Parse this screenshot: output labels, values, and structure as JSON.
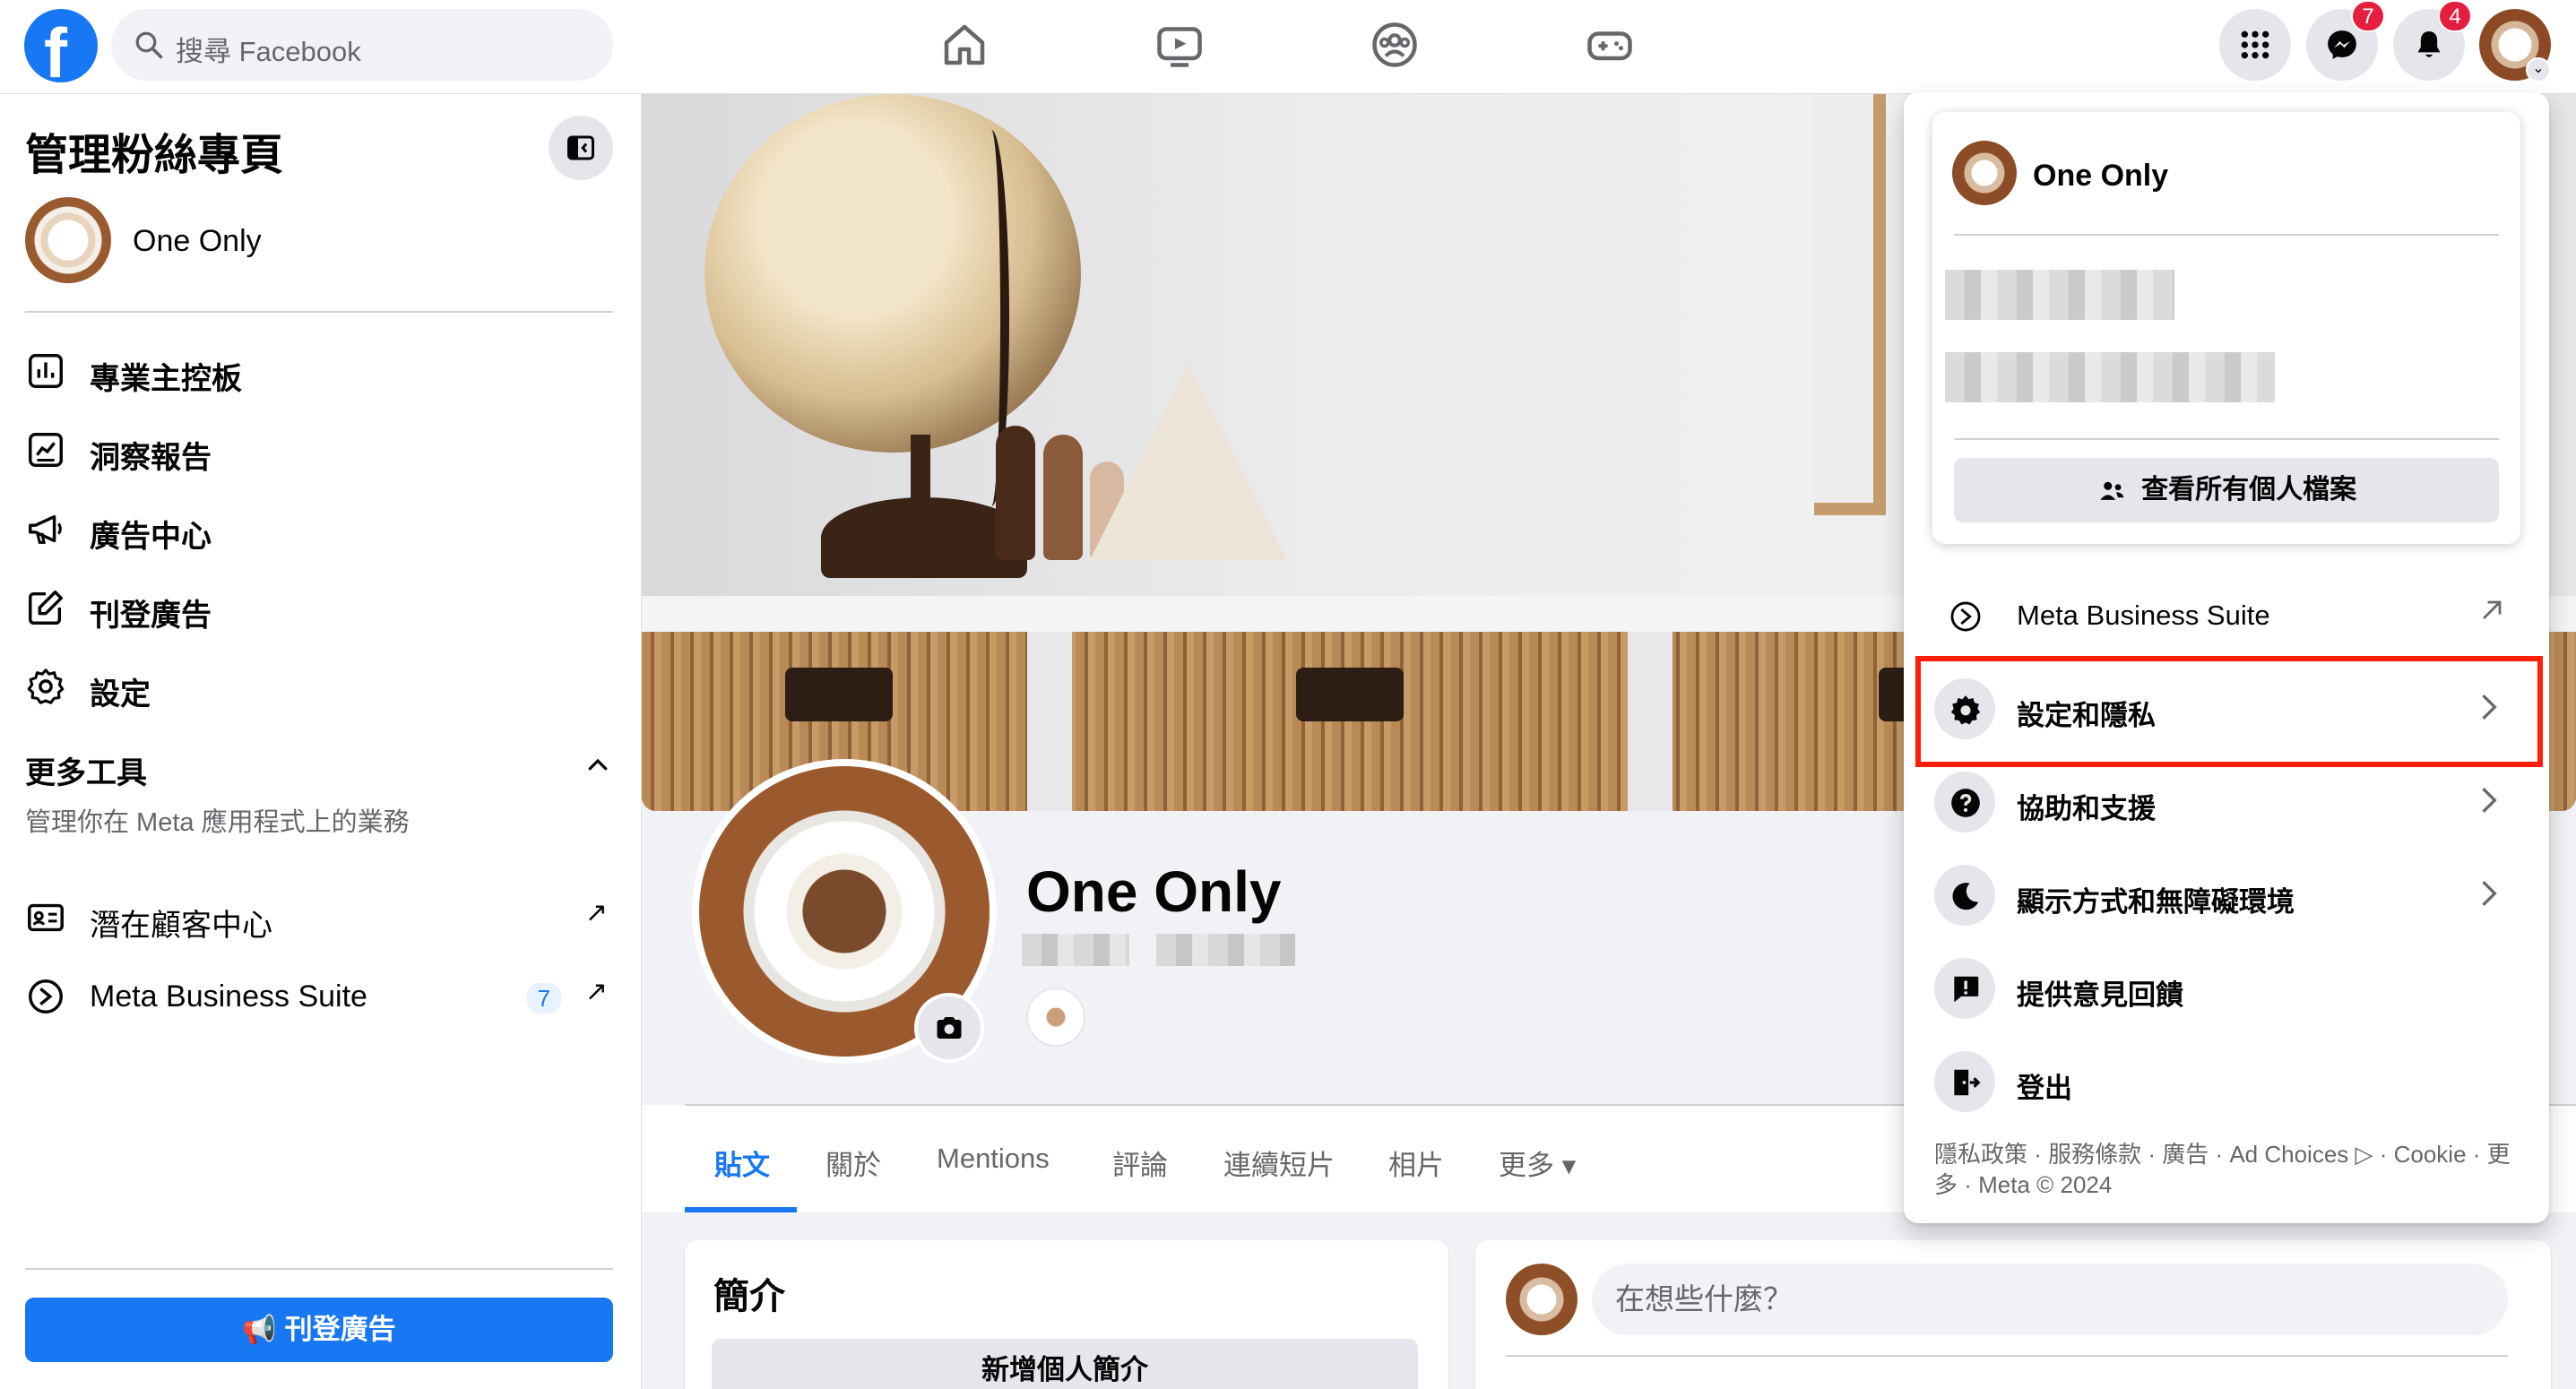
{
  "topbar": {
    "logo": "f",
    "search_placeholder": "搜尋 Facebook",
    "nav_icons": [
      "home-icon",
      "watch-icon",
      "groups-icon",
      "gaming-icon"
    ],
    "messenger_badge": "7",
    "notifications_badge": "4"
  },
  "sidebar": {
    "title": "管理粉絲專頁",
    "page_name": "One Only",
    "items": [
      {
        "label": "專業主控板",
        "icon": "dashboard-icon"
      },
      {
        "label": "洞察報告",
        "icon": "insights-icon"
      },
      {
        "label": "廣告中心",
        "icon": "megaphone-icon"
      },
      {
        "label": "刊登廣告",
        "icon": "edit-icon"
      },
      {
        "label": "設定",
        "icon": "gear-icon"
      }
    ],
    "more_tools_title": "更多工具",
    "more_tools_subtitle": "管理你在 Meta 應用程式上的業務",
    "tools": [
      {
        "label": "潛在顧客中心",
        "icon": "contact-card-icon",
        "ext": "↗"
      },
      {
        "label": "Meta Business Suite",
        "icon": "business-suite-icon",
        "count": "7",
        "ext": "↗"
      }
    ],
    "cta_label": "刊登廣告"
  },
  "profile": {
    "page_name": "One Only",
    "tabs": [
      {
        "label": "貼文",
        "active": true
      },
      {
        "label": "關於"
      },
      {
        "label": "Mentions"
      },
      {
        "label": "評論"
      },
      {
        "label": "連續短片"
      },
      {
        "label": "相片"
      },
      {
        "label": "更多 ▾"
      }
    ],
    "intro_title": "簡介",
    "intro_button": "新增個人簡介",
    "composer_placeholder": "在想些什麼？"
  },
  "account_menu": {
    "profile_name": "One Only",
    "see_all_profiles": "查看所有個人檔案",
    "rows": [
      {
        "label": "Meta Business Suite",
        "icon": "business-suite-icon",
        "trail": "↗"
      },
      {
        "label": "設定和隱私",
        "icon": "gear-icon",
        "trail": "›",
        "highlighted": true
      },
      {
        "label": "協助和支援",
        "icon": "help-icon",
        "trail": "›"
      },
      {
        "label": "顯示方式和無障礙環境",
        "icon": "moon-icon",
        "trail": "›"
      },
      {
        "label": "提供意見回饋",
        "icon": "feedback-icon"
      },
      {
        "label": "登出",
        "icon": "logout-icon"
      }
    ],
    "footer": "隱私政策 · 服務條款 · 廣告 · Ad Choices ▷ · Cookie · 更多 · Meta © 2024"
  },
  "colors": {
    "accent": "#1877f2",
    "badge": "#e41e3f",
    "highlight": "#ff1e0a"
  }
}
